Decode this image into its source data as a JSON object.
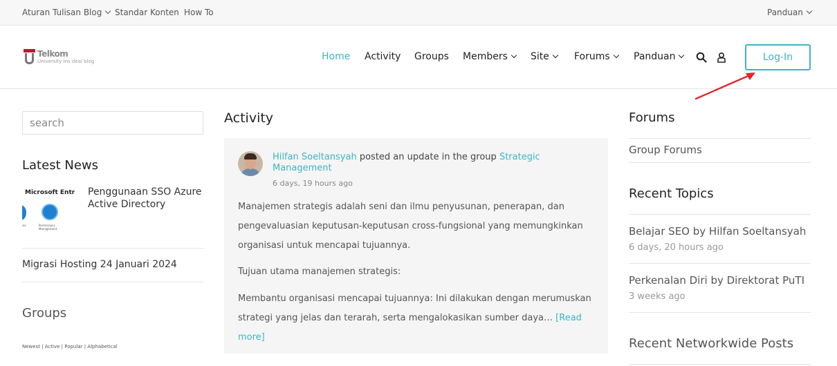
{
  "topbar": {
    "left_items": [
      {
        "label": "Aturan Tulisan Blog",
        "has_dropdown": true
      },
      {
        "label": "Standar Konten",
        "has_dropdown": false
      },
      {
        "label": "How To",
        "has_dropdown": false
      }
    ],
    "right_item": {
      "label": "Panduan",
      "has_dropdown": true
    }
  },
  "header": {
    "logo": {
      "name": "Telkom",
      "subtitle": "University Ins deal blog"
    },
    "nav": [
      {
        "label": "Home",
        "active": true,
        "has_dropdown": false
      },
      {
        "label": "Activity",
        "active": false,
        "has_dropdown": false
      },
      {
        "label": "Groups",
        "active": false,
        "has_dropdown": false
      },
      {
        "label": "Members",
        "active": false,
        "has_dropdown": true
      },
      {
        "label": "Site",
        "active": false,
        "has_dropdown": true
      },
      {
        "label": "Forums",
        "active": false,
        "has_dropdown": true
      },
      {
        "label": "Panduan",
        "active": false,
        "has_dropdown": true
      }
    ],
    "icons": [
      "search-icon",
      "user-icon"
    ],
    "login_label": "Log-In"
  },
  "sidebar_left": {
    "search_placeholder": "search",
    "latest_news_title": "Latest News",
    "news": [
      {
        "title": "Penggunaan SSO Azure Active Directory",
        "thumb_title": "Microsoft Entra",
        "thumb_caption_1": "ies",
        "thumb_caption_2": "Permissions Management"
      },
      {
        "title": "Migrasi Hosting 24 Januari 2024"
      }
    ],
    "groups_title": "Groups",
    "groups_filter": "Newest | Active | Popular | Alphabetical"
  },
  "main": {
    "title": "Activity",
    "post": {
      "author": "Hilfan Soeltansyah",
      "action": " posted an update in the group ",
      "group": "Strategic Management",
      "time": "6 days, 19 hours ago",
      "paragraphs": [
        "Manajemen strategis adalah seni dan ilmu penyusunan, penerapan, dan pengevaluasian keputusan-keputusan cross-fungsional yang memungkinkan organisasi untuk mencapai tujuannya.",
        "Tujuan utama manajemen strategis:",
        "Membantu organisasi mencapai tujuannya: Ini dilakukan dengan merumuskan strategi yang jelas dan terarah, serta mengalokasikan sumber daya…"
      ],
      "read_more": "[Read more]"
    }
  },
  "sidebar_right": {
    "forums_title": "Forums",
    "forums_link": "Group Forums",
    "recent_topics_title": "Recent Topics",
    "topics": [
      {
        "title": "Belajar SEO",
        "by": " by ",
        "author": "Hilfan Soeltansyah",
        "time": "6 days, 20 hours ago"
      },
      {
        "title": "Perkenalan Diri",
        "by": " by ",
        "author": "Direktorat PuTI",
        "time": "3 weeks ago"
      }
    ],
    "networkwide_title": "Recent Networkwide Posts"
  },
  "colors": {
    "accent": "#3bb5c3",
    "arrow": "#e0262b",
    "logo_red": "#b5202e"
  }
}
